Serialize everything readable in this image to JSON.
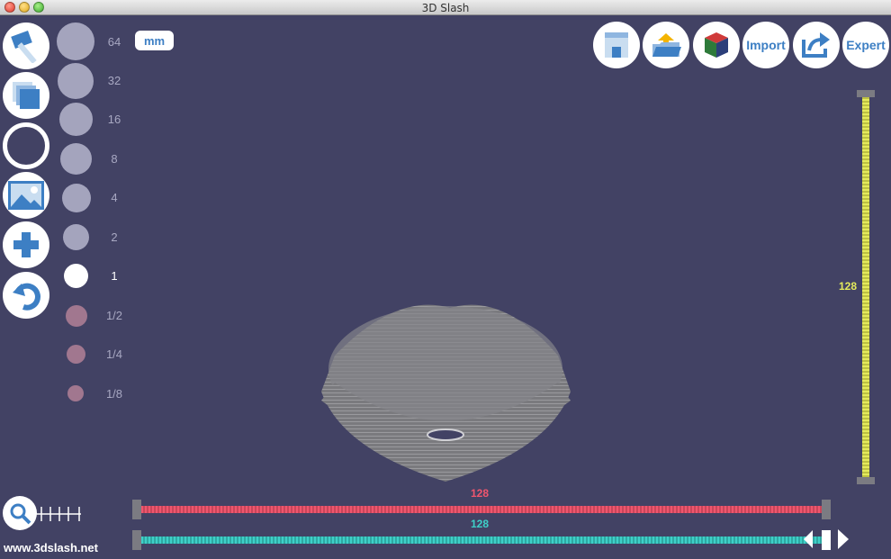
{
  "window": {
    "title": "3D Slash"
  },
  "tools": [
    {
      "name": "hammer-tool-button",
      "icon": "hammer-icon"
    },
    {
      "name": "cube-layers-tool-button",
      "icon": "cube-layers-icon"
    },
    {
      "name": "circle-tool-button",
      "icon": "circle-outline-icon"
    },
    {
      "name": "image-tool-button",
      "icon": "image-icon"
    },
    {
      "name": "add-tool-button",
      "icon": "plus-icon"
    },
    {
      "name": "undo-tool-button",
      "icon": "undo-icon"
    }
  ],
  "sizes": {
    "labels": [
      "64",
      "32",
      "16",
      "8",
      "4",
      "2",
      "1",
      "1/2",
      "1/4",
      "1/8"
    ],
    "selected": "1",
    "unit_label": "mm"
  },
  "top_buttons": {
    "save_icon": "save-icon",
    "open_icon": "open-folder-icon",
    "color_icon": "color-cube-icon",
    "import_label": "Import",
    "share_icon": "share-icon",
    "expert_label": "Expert"
  },
  "sliders": {
    "vertical_value": "128",
    "horizontal_red_value": "128",
    "horizontal_cyan_value": "128"
  },
  "zoom": {
    "icon": "magnifier-icon"
  },
  "footer": {
    "website": "www.3dslash.net"
  },
  "colors": {
    "background": "#424264",
    "accent_blue": "#3d7fc4",
    "slider_yellow": "#e4ea5c",
    "slider_red": "#f0566e",
    "slider_cyan": "#3ed0c8"
  }
}
